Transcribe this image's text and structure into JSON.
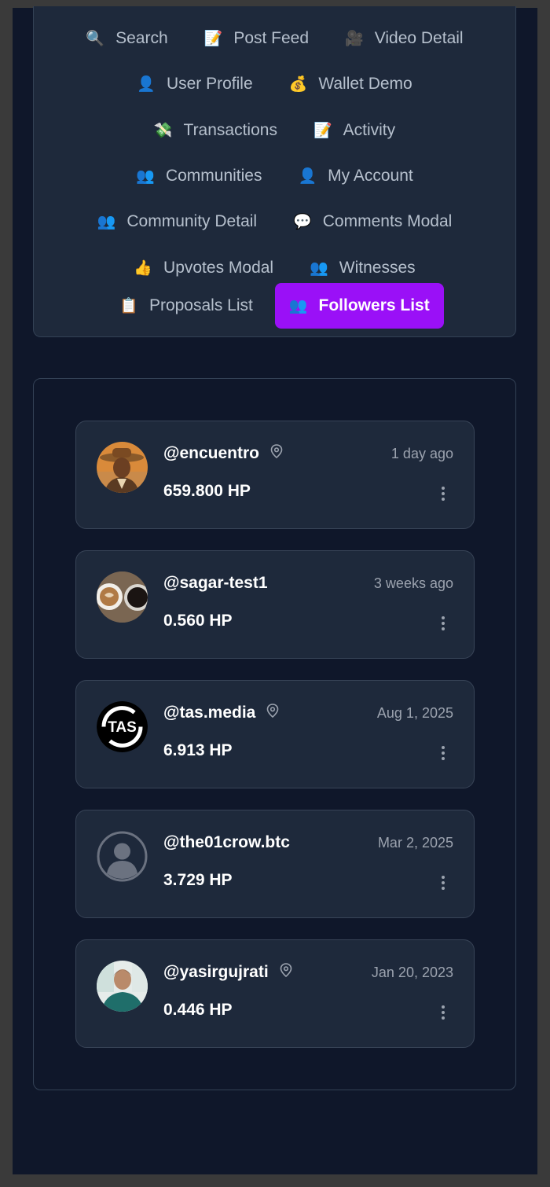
{
  "nav": {
    "items": [
      {
        "icon": "🔍",
        "icon_name": "magnifier-icon",
        "label": "Search"
      },
      {
        "icon": "📝",
        "icon_name": "memo-icon",
        "label": "Post Feed"
      },
      {
        "icon": "🎥",
        "icon_name": "video-camera-icon",
        "label": "Video Detail"
      },
      {
        "icon": "👤",
        "icon_name": "user-icon",
        "label": "User Profile"
      },
      {
        "icon": "💰",
        "icon_name": "money-bag-icon",
        "label": "Wallet Demo"
      },
      {
        "icon": "💸",
        "icon_name": "money-wings-icon",
        "label": "Transactions"
      },
      {
        "icon": "📝",
        "icon_name": "memo-icon",
        "label": "Activity"
      },
      {
        "icon": "👥",
        "icon_name": "users-icon",
        "label": "Communities"
      },
      {
        "icon": "👤",
        "icon_name": "user-icon",
        "label": "My Account"
      },
      {
        "icon": "👥",
        "icon_name": "users-icon",
        "label": "Community Detail"
      },
      {
        "icon": "💬",
        "icon_name": "speech-bubble-icon",
        "label": "Comments Modal"
      },
      {
        "icon": "👍",
        "icon_name": "thumbs-up-icon",
        "label": "Upvotes Modal"
      },
      {
        "icon": "👥",
        "icon_name": "users-icon",
        "label": "Witnesses"
      },
      {
        "icon": "📋",
        "icon_name": "clipboard-icon",
        "label": "Proposals List"
      },
      {
        "icon": "👥",
        "icon_name": "users-icon",
        "label": "Followers List"
      }
    ],
    "active": "Followers List",
    "active_color": "#9a10f7"
  },
  "followers": [
    {
      "username": "@encuentro",
      "has_location": true,
      "date": "1 day ago",
      "hp": "659.800 HP",
      "avatar": "photo-cowboy"
    },
    {
      "username": "@sagar-test1",
      "has_location": false,
      "date": "3 weeks ago",
      "hp": "0.560 HP",
      "avatar": "photo-coffee"
    },
    {
      "username": "@tas.media",
      "has_location": true,
      "date": "Aug 1, 2025",
      "hp": "6.913 HP",
      "avatar": "tas-logo",
      "avatar_text": "TAS"
    },
    {
      "username": "@the01crow.btc",
      "has_location": false,
      "date": "Mar 2, 2025",
      "hp": "3.729 HP",
      "avatar": "default-user"
    },
    {
      "username": "@yasirgujrati",
      "has_location": true,
      "date": "Jan 20, 2023",
      "hp": "0.446 HP",
      "avatar": "photo-person"
    }
  ],
  "colors": {
    "background": "#0f172a",
    "panel": "#1e293b",
    "border": "#334155",
    "muted_text": "#9ca3af"
  }
}
